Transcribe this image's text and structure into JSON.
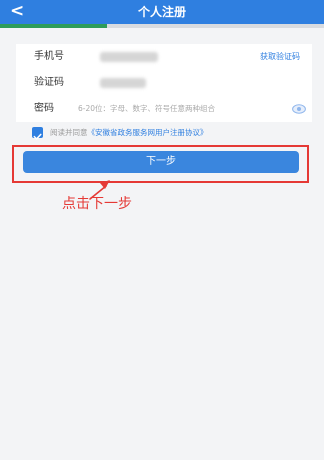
{
  "header": {
    "back_icon": "chevron-left-icon",
    "title": "个人注册",
    "step_progress": 0.33
  },
  "form": {
    "phone": {
      "label": "手机号",
      "action": "获取验证码"
    },
    "code": {
      "label": "验证码"
    },
    "password": {
      "label": "密码",
      "placeholder": "6-20位：字母、数字、符号任意两种组合",
      "toggle_icon": "eye-icon"
    }
  },
  "agreement": {
    "checked": true,
    "prefix": "阅读并同意",
    "link": "《安徽省政务服务网用户注册协议》"
  },
  "next_button": {
    "label": "下一步"
  },
  "annotation": {
    "text": "点击下一步"
  },
  "colors": {
    "primary": "#2f7fe0",
    "progress": "#2e9c5a",
    "annotation": "#e53935"
  }
}
